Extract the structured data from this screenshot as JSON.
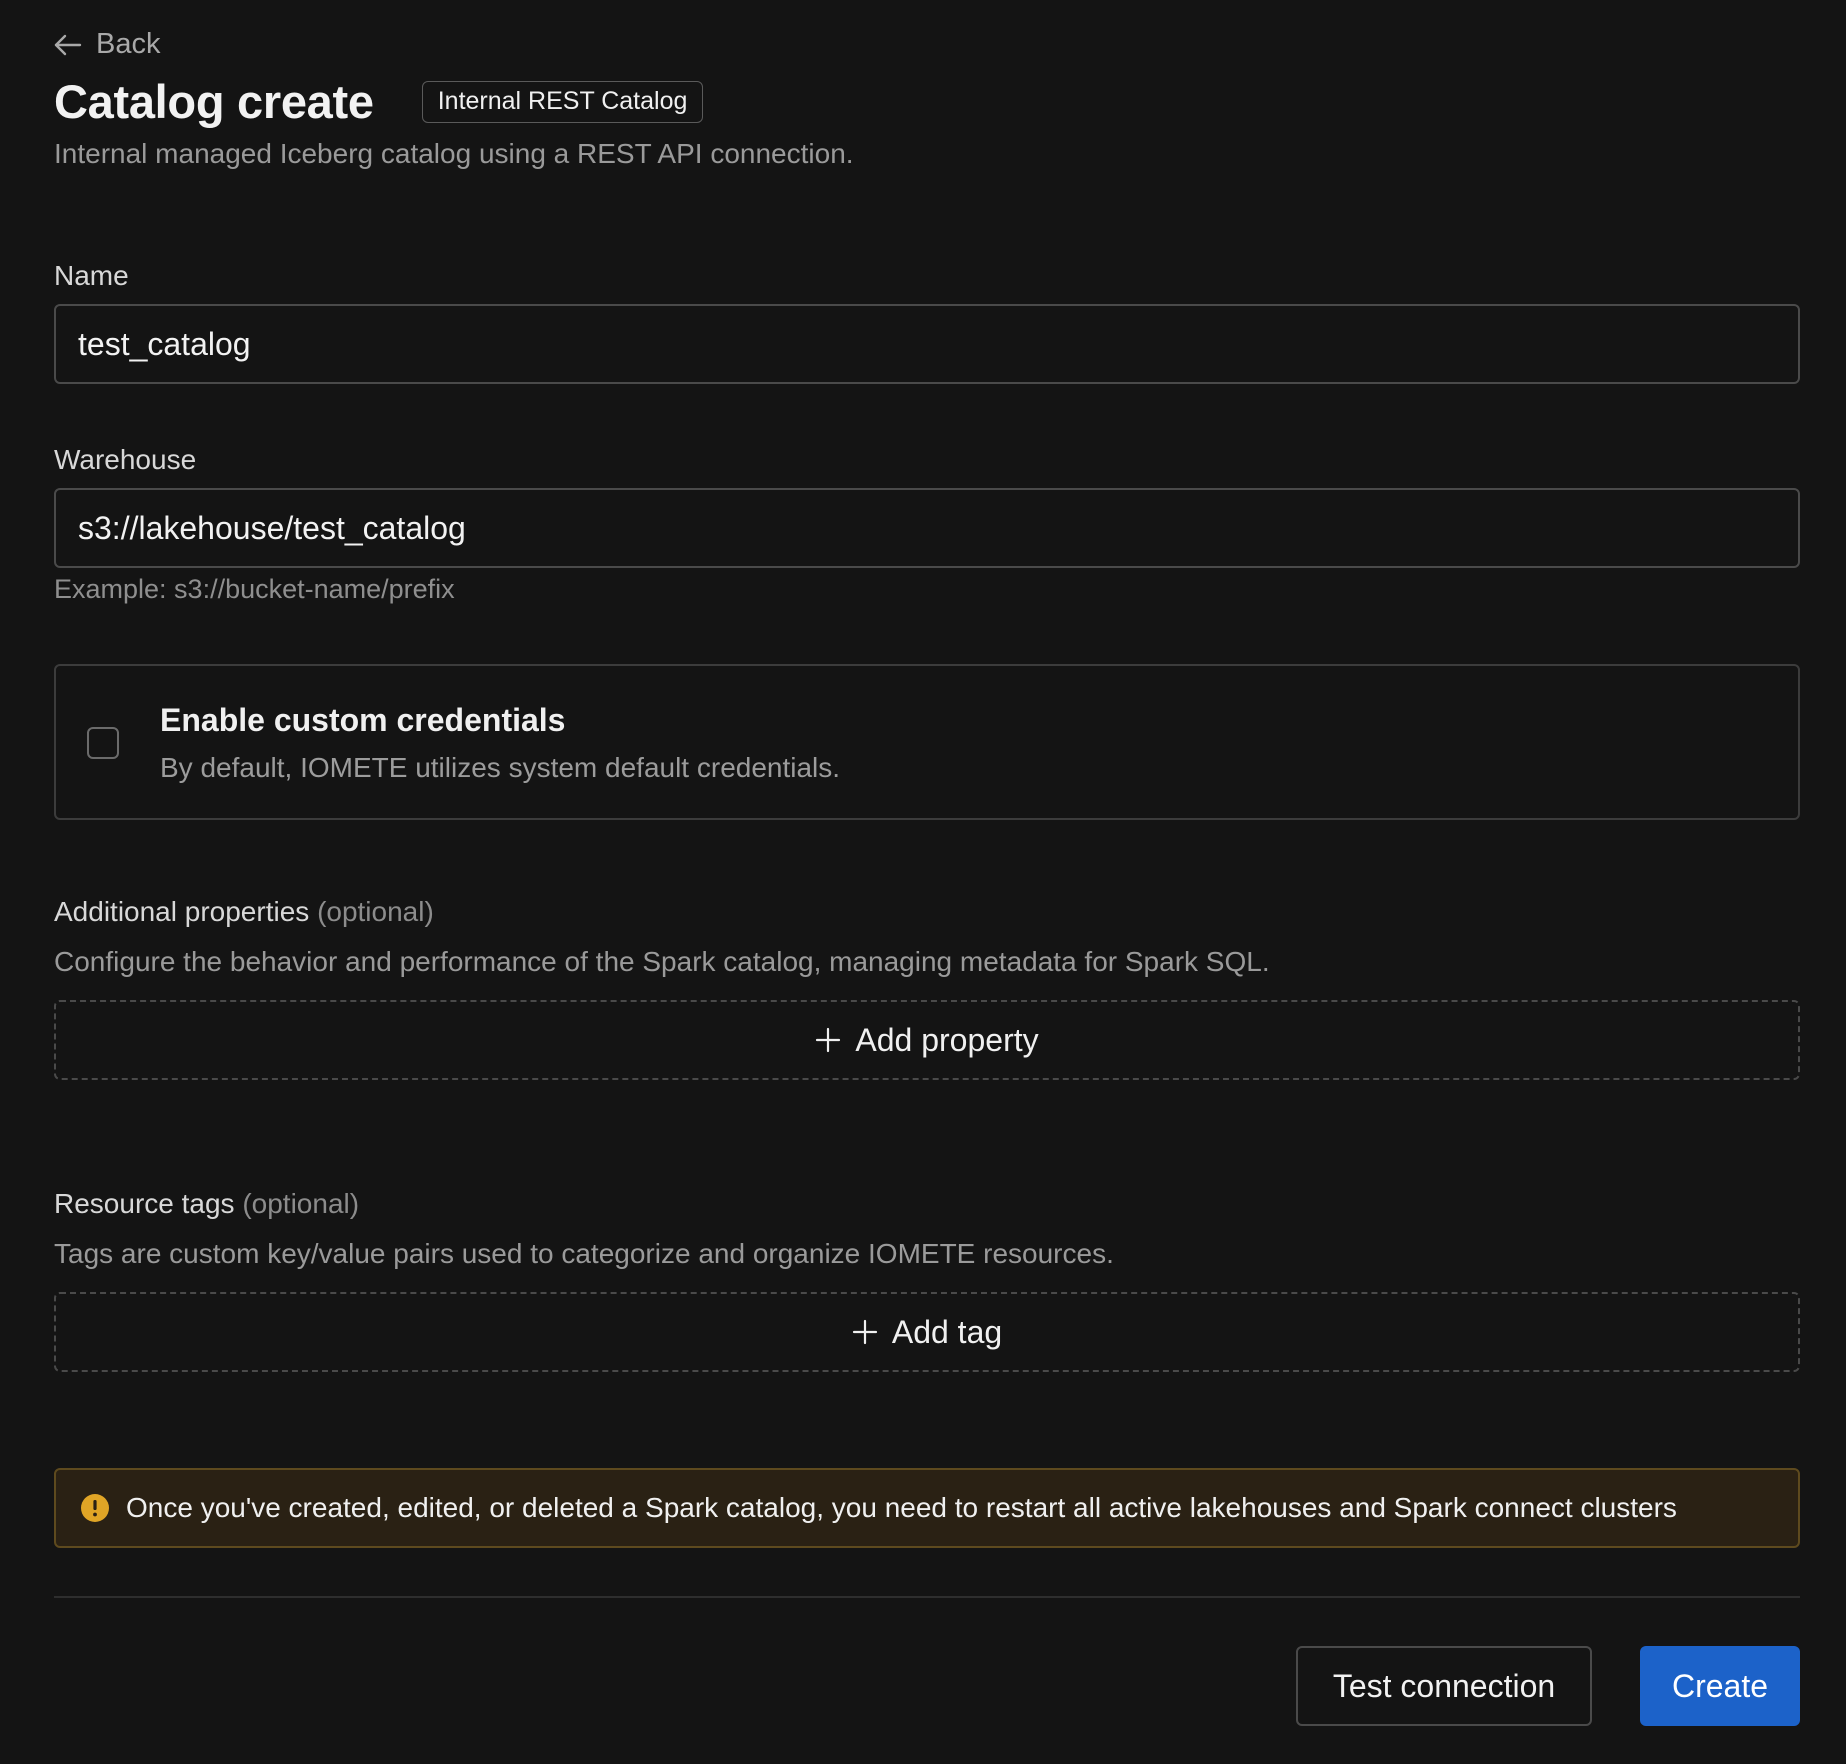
{
  "header": {
    "back_label": "Back",
    "title": "Catalog create",
    "badge": "Internal REST Catalog",
    "subtitle": "Internal managed Iceberg catalog using a REST API connection."
  },
  "form": {
    "name": {
      "label": "Name",
      "value": "test_catalog"
    },
    "warehouse": {
      "label": "Warehouse",
      "value": "s3://lakehouse/test_catalog",
      "hint": "Example: s3://bucket-name/prefix"
    },
    "credentials": {
      "title": "Enable custom credentials",
      "description": "By default, IOMETE utilizes system default credentials.",
      "checked": false
    },
    "properties": {
      "label": "Additional properties",
      "optional": "(optional)",
      "description": "Configure the behavior and performance of the Spark catalog, managing metadata for Spark SQL.",
      "add_label": "Add property"
    },
    "tags": {
      "label": "Resource tags",
      "optional": "(optional)",
      "description": "Tags are custom key/value pairs used to categorize and organize IOMETE resources.",
      "add_label": "Add tag"
    }
  },
  "alert": {
    "icon": "warning-icon",
    "color": "#e0a526",
    "message": "Once you've created, edited, or deleted a Spark catalog, you need to restart all active lakehouses and Spark connect clusters"
  },
  "actions": {
    "test_label": "Test connection",
    "create_label": "Create",
    "primary_color": "#1c62c9"
  }
}
